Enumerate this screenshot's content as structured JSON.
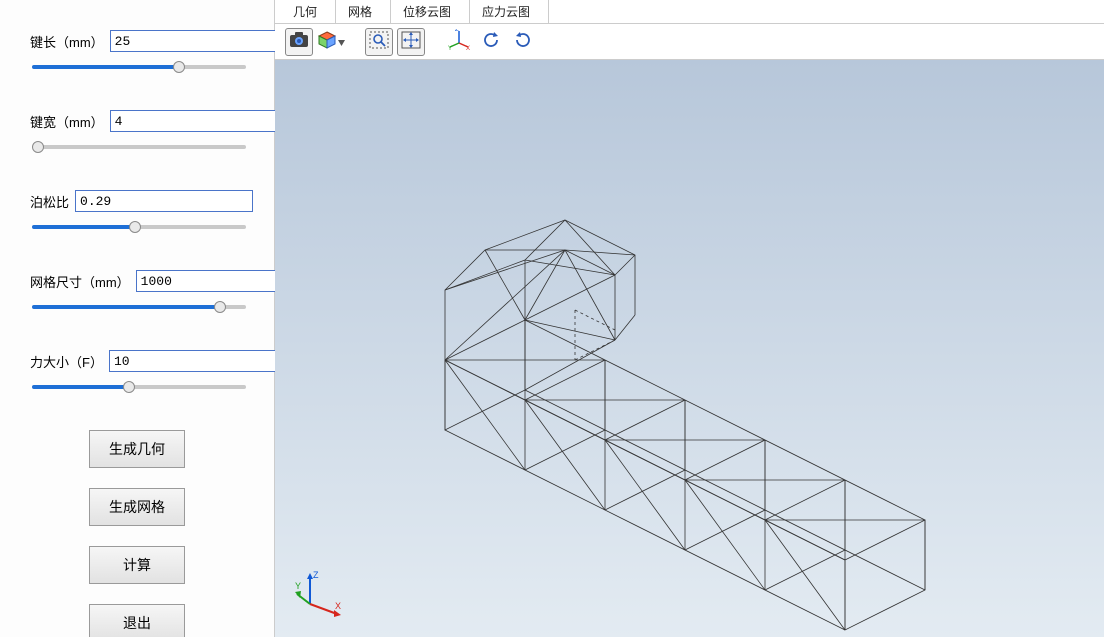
{
  "params": {
    "key_length": {
      "label": "键长（mm）",
      "value": "25",
      "slider": 70
    },
    "key_width": {
      "label": "键宽（mm）",
      "value": "4",
      "slider": 0
    },
    "poisson": {
      "label": "泊松比",
      "value": "0.29",
      "slider": 48
    },
    "mesh_size": {
      "label": "网格尺寸（mm）",
      "value": "1000",
      "slider": 90
    },
    "force": {
      "label": "力大小（F）",
      "value": "10",
      "slider": 45
    }
  },
  "buttons": {
    "gen_geom": "生成几何",
    "gen_mesh": "生成网格",
    "compute": "计算",
    "exit": "退出"
  },
  "tabs": {
    "geometry": "几何",
    "mesh": "网格",
    "disp_contour": "位移云图",
    "stress_contour": "应力云图"
  },
  "toolbar_icons": {
    "screenshot": "camera-icon",
    "view_cube": "cube-iso-icon",
    "zoom_area": "zoom-area-icon",
    "fit_view": "fit-view-icon",
    "axes_toggle": "axes-icon",
    "rotate_ccw": "rotate-ccw-icon",
    "rotate_cw": "rotate-cw-icon"
  },
  "axis_labels": {
    "x": "X",
    "y": "Y",
    "z": "Z"
  }
}
